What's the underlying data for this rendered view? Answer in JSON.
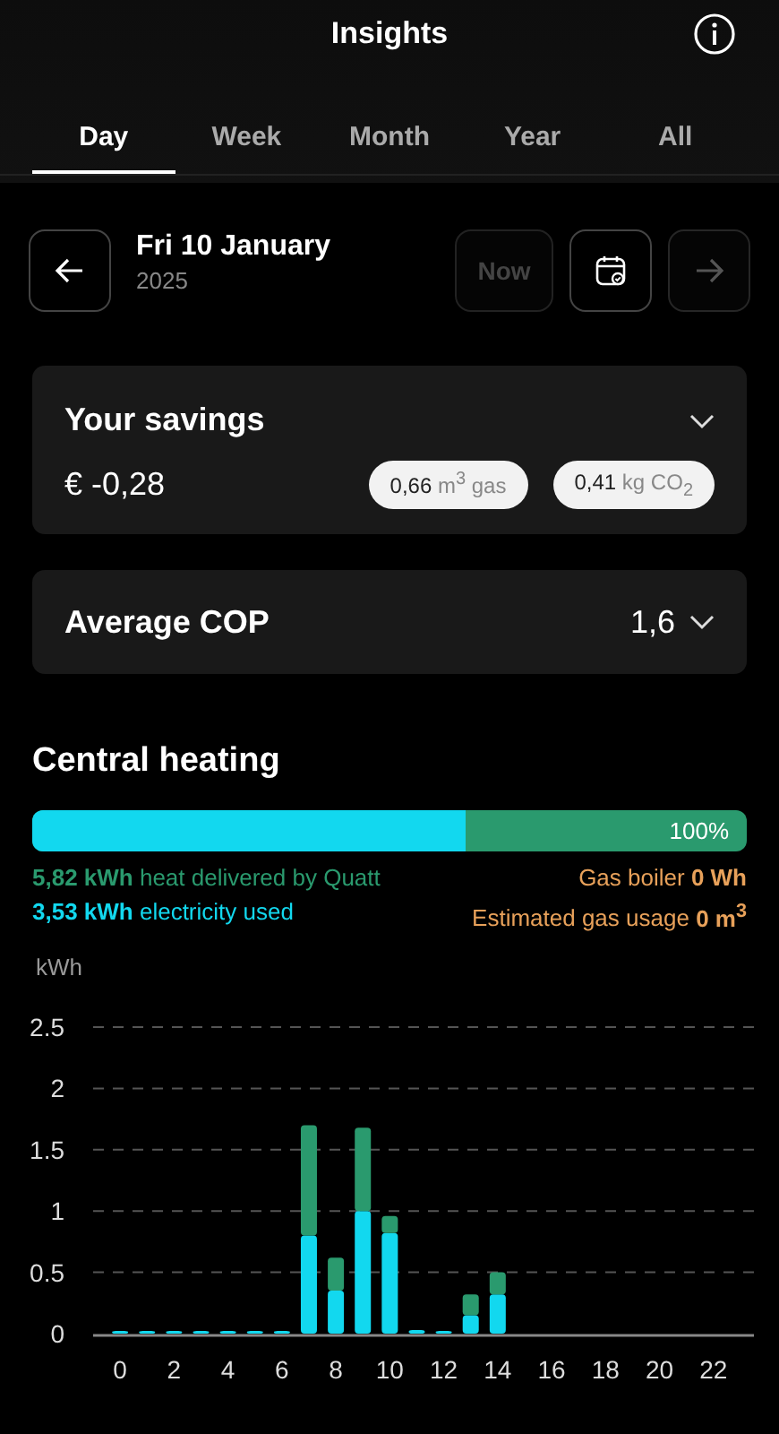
{
  "header": {
    "title": "Insights"
  },
  "tabs": [
    {
      "label": "Day",
      "selected": true
    },
    {
      "label": "Week",
      "selected": false
    },
    {
      "label": "Month",
      "selected": false
    },
    {
      "label": "Year",
      "selected": false
    },
    {
      "label": "All",
      "selected": false
    }
  ],
  "date": {
    "title": "Fri 10 January",
    "year": "2025",
    "prev_disabled": false,
    "next_disabled": true,
    "now": {
      "label": "Now",
      "disabled": true
    }
  },
  "savings": {
    "title": "Your savings",
    "expanded": false,
    "amount": "€ -0,28",
    "chips": [
      {
        "value": "0,66",
        "unit": "m$^{3}$ gas"
      },
      {
        "value": "0,41",
        "unit": "kg CO$_{2}$"
      }
    ]
  },
  "cop": {
    "title": "Average COP",
    "value": "1,6",
    "expanded": false
  },
  "heating": {
    "title": "Central heating",
    "level": 0.607,
    "percent": "100%",
    "legend_left": [
      {
        "text": "**5,82 kWh** heat delivered by Quatt",
        "color": "#2a9a6e"
      },
      {
        "text": "**3,53 kWh** electricity used",
        "color": "#12d8ef"
      }
    ],
    "legend_right": [
      {
        "text": "Gas boiler **0 Wh**",
        "color": "#e8a15a"
      },
      {
        "text": "Estimated gas usage **0 m$^{3}$**",
        "color": "#e8a15a"
      }
    ],
    "chart_data": {
      "type": "bar",
      "stacked": true,
      "ylabel": "kWh",
      "x": [
        0,
        1,
        2,
        3,
        4,
        5,
        6,
        7,
        8,
        9,
        10,
        11,
        12,
        13,
        14
      ],
      "grid": true,
      "xlim": [
        -1,
        23.5
      ],
      "series": [
        {
          "color": "#12d8ef",
          "values": [
            0.02,
            0.02,
            0.01,
            0.02,
            0.01,
            0.01,
            0.02,
            0.8,
            0.35,
            1.0,
            0.82,
            0.03,
            0.01,
            0.15,
            0.32
          ]
        },
        {
          "color": "#2a9a6e",
          "values": [
            0,
            0,
            0,
            0,
            0,
            0,
            0,
            0.9,
            0.27,
            0.68,
            0.14,
            0,
            0,
            0.17,
            0.18
          ]
        }
      ],
      "ylim": [
        0,
        2.5
      ],
      "yticks": [
        0,
        0.5,
        1,
        1.5,
        2,
        2.5
      ],
      "xticks": [
        0,
        2,
        4,
        6,
        8,
        10,
        12,
        14,
        16,
        18,
        20,
        22
      ]
    }
  }
}
